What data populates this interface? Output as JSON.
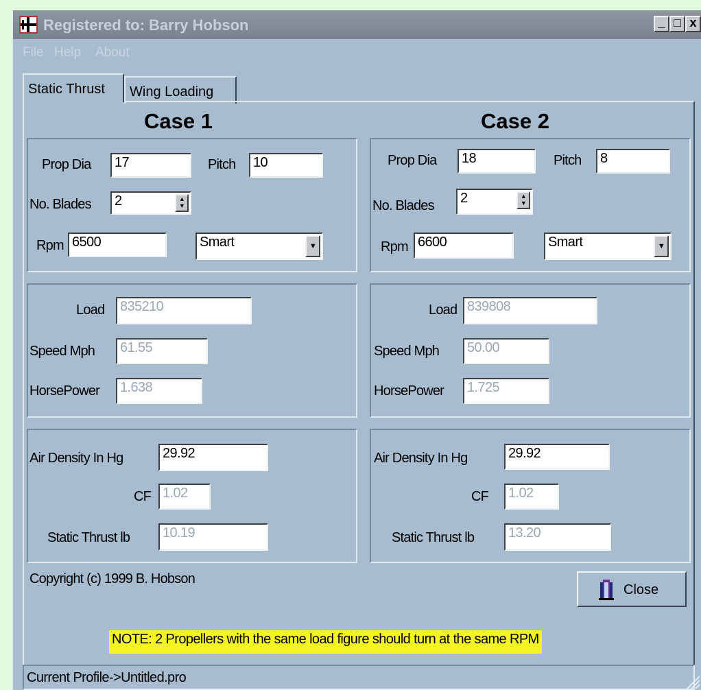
{
  "window": {
    "title": "Registered to: Barry Hobson",
    "controls": [
      "_",
      "□",
      "x"
    ]
  },
  "menu": {
    "file": "File",
    "help": "Help",
    "about": "About"
  },
  "tabs": [
    {
      "label": "Static Thrust",
      "active": true
    },
    {
      "label": "Wing Loading",
      "active": false
    }
  ],
  "case1": {
    "title": "Case 1",
    "prop_dia_label": "Prop Dia",
    "prop_dia": "17",
    "pitch_label": "Pitch",
    "pitch": "10",
    "blades_label": "No. Blades",
    "blades": "2",
    "rpm_label": "Rpm",
    "rpm": "6500",
    "prop_type": "Smart",
    "load_label": "Load",
    "load": "835210",
    "speed_label": "Speed Mph",
    "speed": "61.55",
    "hp_label": "HorsePower",
    "hp": "1.638",
    "air_density_label": "Air Density In Hg",
    "air_density": "29.92",
    "cf_label": "CF",
    "cf": "1.02",
    "thrust_label": "Static Thrust lb",
    "thrust": "10.19"
  },
  "case2": {
    "title": "Case 2",
    "prop_dia_label": "Prop Dia",
    "prop_dia": "18",
    "pitch_label": "Pitch",
    "pitch": "8",
    "blades_label": "No. Blades",
    "blades": "2",
    "rpm_label": "Rpm",
    "rpm": "6600",
    "prop_type": "Smart",
    "load_label": "Load",
    "load": "839808",
    "speed_label": "Speed Mph",
    "speed": "50.00",
    "hp_label": "HorsePower",
    "hp": "1.725",
    "air_density_label": "Air Density In Hg",
    "air_density": "29.92",
    "cf_label": "CF",
    "cf": "1.02",
    "thrust_label": "Static Thrust lb",
    "thrust": "13.20"
  },
  "copyright": "Copyright (c) 1999 B. Hobson",
  "close_button": {
    "label": "Close",
    "icon": "door-icon"
  },
  "note": "NOTE: 2 Propellers with the same load figure should turn at the same RPM",
  "status": "Current Profile->Untitled.pro",
  "colors": {
    "page_background": "#e2fbdf",
    "window_background": "#a8bccf",
    "titlebar": "#868d99",
    "note_highlight": "#f4f423",
    "readonly_text": "#9aa7b5"
  }
}
